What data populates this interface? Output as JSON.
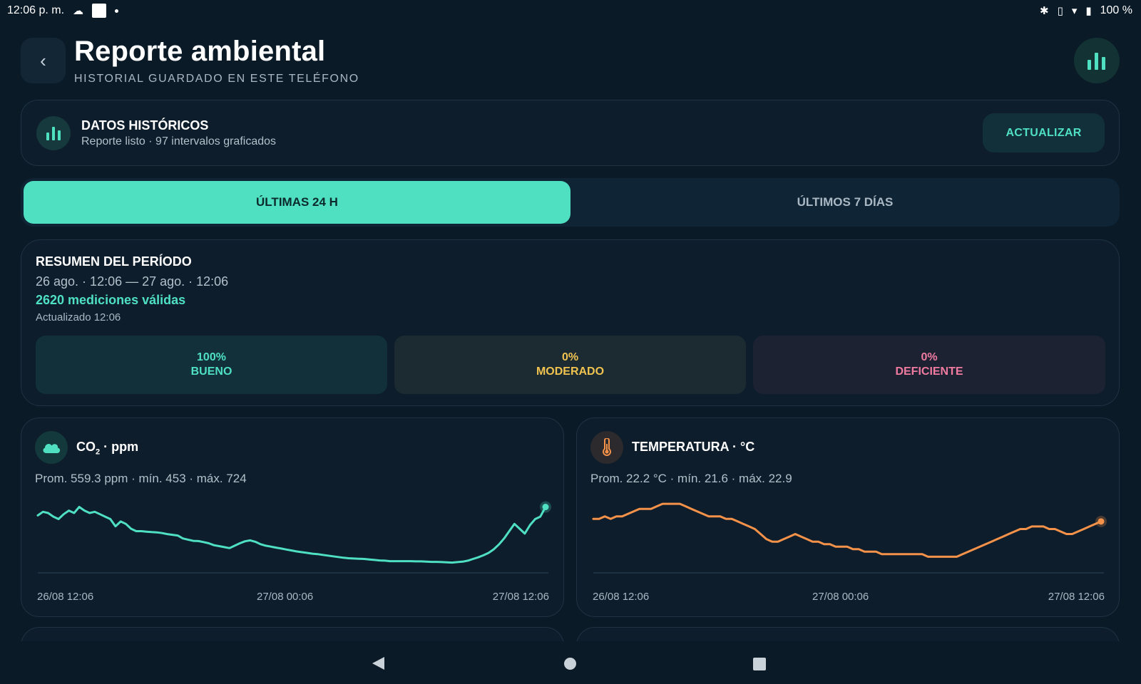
{
  "status_bar": {
    "time": "12:06 p. m.",
    "battery": "100 %"
  },
  "header": {
    "back_label": "‹",
    "title": "Reporte ambiental",
    "subtitle": "HISTORIAL GUARDADO EN ESTE TELÉFONO"
  },
  "history_card": {
    "title": "DATOS HISTÓRICOS",
    "subtitle": "Reporte listo · 97 intervalos graficados",
    "update_label": "ACTUALIZAR"
  },
  "tabs": [
    {
      "label": "ÚLTIMAS 24 H",
      "active": true
    },
    {
      "label": "ÚLTIMOS 7 DÍAS",
      "active": false
    }
  ],
  "summary": {
    "title": "RESUMEN DEL PERÍODO",
    "range": "26 ago. · 12:06  —  27 ago. · 12:06",
    "count": "2620 mediciones válidas",
    "updated": "Actualizado 12:06",
    "quality": [
      {
        "percent": "100%",
        "label": "BUENO",
        "color": "#4fe0c2"
      },
      {
        "percent": "0%",
        "label": "MODERADO",
        "color": "#f0c350"
      },
      {
        "percent": "0%",
        "label": "DEFICIENTE",
        "color": "#f07ba0"
      }
    ]
  },
  "metrics": {
    "co2": {
      "title_prefix": "CO",
      "title_sub": "2",
      "title_unit": "· ppm",
      "stats": "Prom. 559.3 ppm   ·   mín. 453   ·   máx. 724",
      "color": "#4fe0c2",
      "x_labels": [
        "26/08 12:06",
        "27/08 00:06",
        "27/08 12:06"
      ]
    },
    "temperature": {
      "title": "TEMPERATURA  ·  °C",
      "stats": "Prom. 22.2 °C   ·   mín. 21.6   ·   máx. 22.9",
      "color": "#f5924a",
      "x_labels": [
        "26/08 12:06",
        "27/08 00:06",
        "27/08 12:06"
      ]
    }
  },
  "chart_data": [
    {
      "type": "line",
      "title": "CO₂ · ppm",
      "xlabel": "",
      "ylabel": "",
      "x_ticks": [
        "26/08 12:06",
        "27/08 00:06",
        "27/08 12:06"
      ],
      "ylim": [
        453,
        724
      ],
      "grid": false,
      "series": [
        {
          "values": [
            655,
            670,
            665,
            650,
            640,
            660,
            675,
            665,
            690,
            675,
            665,
            670,
            660,
            650,
            640,
            610,
            630,
            620,
            600,
            590,
            590,
            588,
            586,
            585,
            582,
            578,
            575,
            572,
            560,
            555,
            550,
            549,
            545,
            540,
            532,
            528,
            524,
            520,
            530,
            540,
            548,
            552,
            546,
            536,
            530,
            526,
            522,
            518,
            514,
            510,
            506,
            503,
            500,
            497,
            495,
            492,
            489,
            486,
            483,
            480,
            478,
            477,
            476,
            475,
            473,
            471,
            469,
            468,
            466,
            466,
            466,
            466,
            466,
            465,
            465,
            464,
            463,
            463,
            462,
            461,
            460,
            462,
            464,
            468,
            475,
            482,
            490,
            500,
            515,
            535,
            560,
            590,
            620,
            600,
            580,
            615,
            640,
            650,
            690
          ]
        }
      ]
    },
    {
      "type": "line",
      "title": "TEMPERATURA · °C",
      "xlabel": "",
      "ylabel": "",
      "x_ticks": [
        "26/08 12:06",
        "27/08 00:06",
        "27/08 12:06"
      ],
      "ylim": [
        21.6,
        22.9
      ],
      "grid": false,
      "series": [
        {
          "values": [
            22.5,
            22.5,
            22.55,
            22.5,
            22.55,
            22.55,
            22.6,
            22.65,
            22.7,
            22.7,
            22.7,
            22.75,
            22.8,
            22.8,
            22.8,
            22.8,
            22.75,
            22.7,
            22.65,
            22.6,
            22.55,
            22.55,
            22.55,
            22.5,
            22.5,
            22.45,
            22.4,
            22.35,
            22.3,
            22.2,
            22.1,
            22.05,
            22.05,
            22.1,
            22.15,
            22.2,
            22.15,
            22.1,
            22.05,
            22.05,
            22.0,
            22.0,
            21.95,
            21.95,
            21.95,
            21.9,
            21.9,
            21.85,
            21.85,
            21.85,
            21.8,
            21.8,
            21.8,
            21.8,
            21.8,
            21.8,
            21.8,
            21.8,
            21.75,
            21.75,
            21.75,
            21.75,
            21.75,
            21.75,
            21.8,
            21.85,
            21.9,
            21.95,
            22.0,
            22.05,
            22.1,
            22.15,
            22.2,
            22.25,
            22.3,
            22.3,
            22.35,
            22.35,
            22.35,
            22.3,
            22.3,
            22.25,
            22.2,
            22.2,
            22.25,
            22.3,
            22.35,
            22.4,
            22.45
          ]
        }
      ]
    }
  ]
}
